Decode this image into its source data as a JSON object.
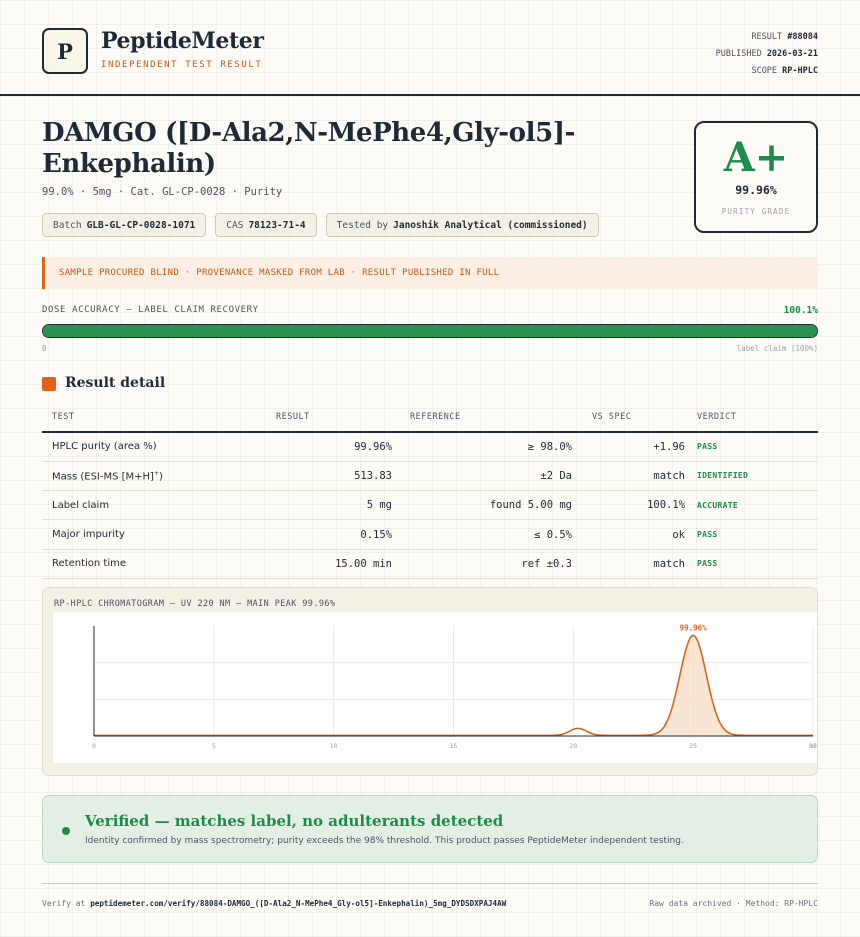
{
  "header": {
    "logo_letter": "P",
    "brand": "PeptideMeter",
    "tagline": "INDEPENDENT TEST RESULT",
    "result_label": "RESULT",
    "result_value": "#88084",
    "published_label": "PUBLISHED",
    "published_value": "2026-03-21",
    "scope_label": "SCOPE",
    "scope_value": "RP-HPLC"
  },
  "product": {
    "title": "DAMGO ([D-Ala2,N-MePhe4,Gly-ol5]-Enkephalin)",
    "subtitle": "99.0% · 5mg · Cat. GL-CP-0028 · Purity",
    "chips": [
      {
        "label": "Batch",
        "value": "GLB-GL-CP-0028-1071"
      },
      {
        "label": "CAS",
        "value": "78123-71-4"
      },
      {
        "label": "Tested by",
        "value": "Janoshik Analytical (commissioned)"
      }
    ]
  },
  "grade": {
    "letter": "A+",
    "value": "99.96%",
    "label": "PURITY GRADE"
  },
  "alert": {
    "text": "SAMPLE PROCURED BLIND · PROVENANCE MASKED FROM LAB · RESULT PUBLISHED IN FULL"
  },
  "dose": {
    "label": "DOSE ACCURACY — LABEL CLAIM RECOVERY",
    "value": "100.1%",
    "fill_fraction": 1.0,
    "min_label": "0",
    "max_label": "label claim (100%)"
  },
  "result_detail": {
    "title": "Result detail",
    "headers": [
      "TEST",
      "RESULT",
      "REFERENCE",
      "VS SPEC",
      "VERDICT"
    ],
    "rows": [
      {
        "test": "HPLC purity (area %)",
        "sup": "",
        "result": "99.96%",
        "reference": "≥ 98.0%",
        "vs_spec": "+1.96",
        "verdict": "PASS"
      },
      {
        "test": "Mass (ESI-MS [M+H]",
        "sup": "+",
        "test_suffix": ")",
        "result": "513.83",
        "reference": "±2 Da",
        "vs_spec": "match",
        "verdict": "IDENTIFIED"
      },
      {
        "test": "Label claim",
        "sup": "",
        "result": "5 mg",
        "reference": "found 5.00 mg",
        "vs_spec": "100.1%",
        "verdict": "ACCURATE"
      },
      {
        "test": "Major impurity",
        "sup": "",
        "result": "0.15%",
        "reference": "≤ 0.5%",
        "vs_spec": "ok",
        "verdict": "PASS"
      },
      {
        "test": "Retention time",
        "sup": "",
        "result": "15.00 min",
        "reference": "ref ±0.3",
        "vs_spec": "match",
        "verdict": "PASS"
      }
    ]
  },
  "chromatogram": {
    "title": "RP-HPLC CHROMATOGRAM — UV 220 NM — MAIN PEAK 99.96%"
  },
  "chart_data": {
    "type": "line",
    "title": "RP-HPLC CHROMATOGRAM — UV 220 NM — MAIN PEAK 99.96%",
    "xlabel": "",
    "ylabel": "",
    "x_ticks": [
      "0",
      "5",
      "10",
      "15",
      "20",
      "25",
      "30",
      "min"
    ],
    "xlim": [
      0,
      30
    ],
    "ylim": [
      0,
      1.1
    ],
    "peaks": [
      {
        "center": 20.2,
        "height": 0.07,
        "width": 0.35
      },
      {
        "center": 25.0,
        "height": 1.0,
        "width": 0.55
      }
    ],
    "main_peak_label": "99.96%",
    "color": "#d9651c"
  },
  "verified": {
    "title": "Verified — matches label, no adulterants detected",
    "description": "Identity confirmed by mass spectrometry; purity exceeds the 98% threshold. This product passes PeptideMeter independent testing."
  },
  "footer": {
    "verify_prefix": "Verify at",
    "verify_url": "peptidemeter.com/verify/88084-DAMGO_([D-Ala2_N-MePhe4_Gly-ol5]-Enkephalin)_5mg_DYDSDXPAJ4AW",
    "right_text": "Raw data archived · Method: RP-HPLC"
  }
}
